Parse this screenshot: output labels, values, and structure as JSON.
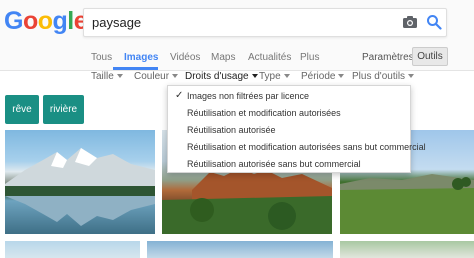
{
  "logo": {
    "letters": [
      "G",
      "o",
      "o",
      "g",
      "l",
      "e"
    ]
  },
  "search": {
    "value": "paysage"
  },
  "icons": {
    "camera": "camera-icon",
    "search": "search-icon",
    "check": "check-icon",
    "caret": "caret-down-icon"
  },
  "colors": {
    "blue": "#4285f4",
    "red": "#ea4335",
    "yellow": "#fbbc05",
    "green": "#34a853",
    "chip": "#1a8f84"
  },
  "tabs": {
    "items": [
      "Tous",
      "Images",
      "Vidéos",
      "Maps",
      "Actualités",
      "Plus"
    ],
    "active": "Images",
    "params": "Paramètres",
    "tools": "Outils"
  },
  "filters": {
    "items": [
      "Taille",
      "Couleur",
      "Droits d'usage",
      "Type",
      "Période",
      "Plus d'outils"
    ],
    "open": "Droits d'usage"
  },
  "chips": [
    "rêve",
    "rivière"
  ],
  "dropdown": {
    "items": [
      "Images non filtrées par licence",
      "Réutilisation et modification autorisées",
      "Réutilisation autorisée",
      "Réutilisation et modification autorisées sans but commercial",
      "Réutilisation autorisée sans but commercial"
    ],
    "selected_index": 0
  }
}
